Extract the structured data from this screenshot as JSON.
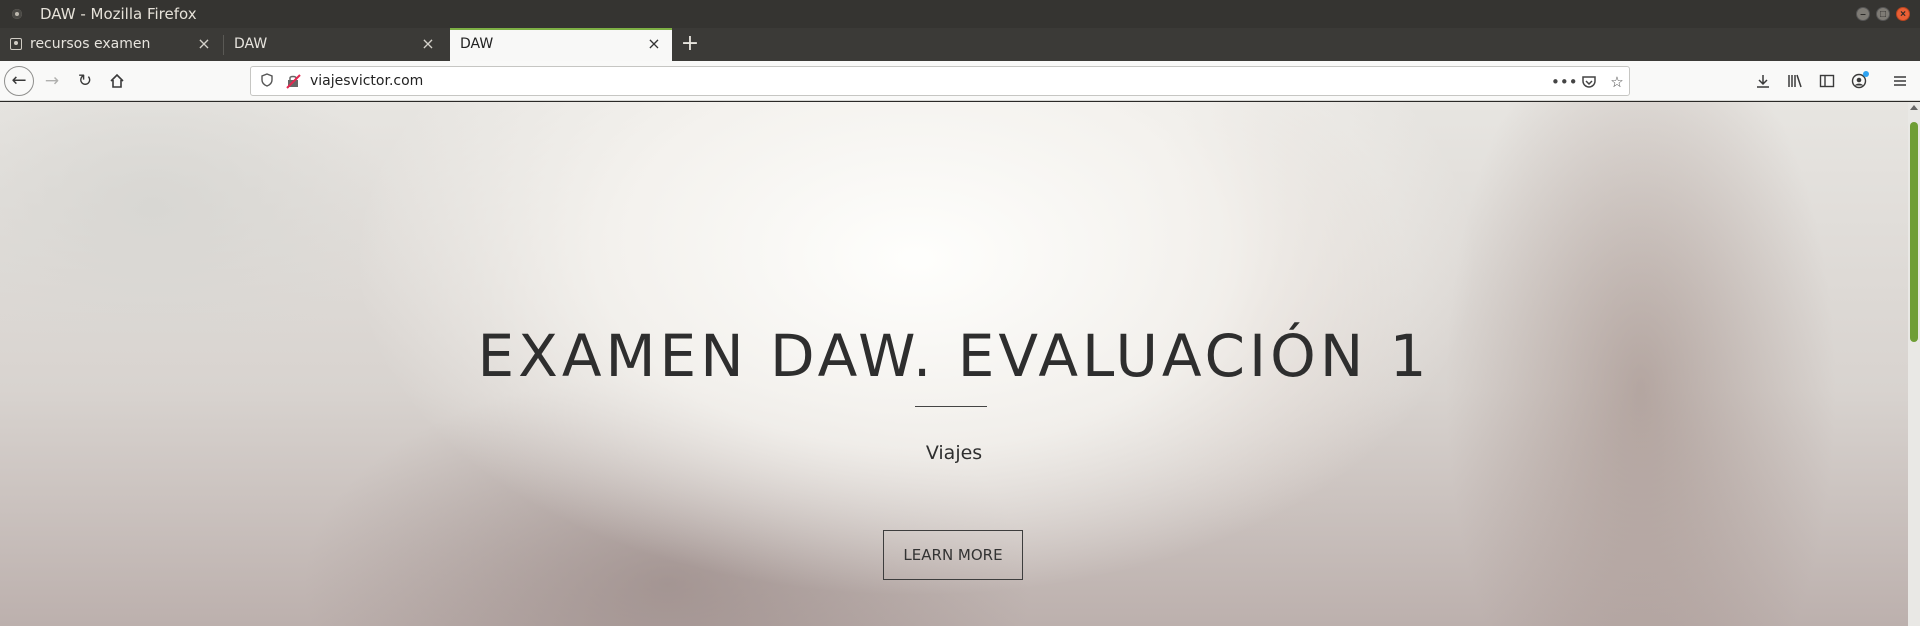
{
  "window": {
    "title": "DAW - Mozilla Firefox"
  },
  "tabs": [
    {
      "label": "recursos examen"
    },
    {
      "label": "DAW"
    },
    {
      "label": "DAW",
      "active": true
    }
  ],
  "nav": {
    "url": "viajesvictor.com"
  },
  "hero": {
    "title": "EXAMEN DAW. EVALUACIÓN 1",
    "subtitle": "Viajes",
    "button_label": "LEARN MORE"
  },
  "icons": {
    "new_tab": "+",
    "close": "×",
    "back": "arrow-left",
    "forward": "arrow-right",
    "reload": "reload",
    "home": "home"
  },
  "colors": {
    "active_tab_accent": "#7eb045",
    "scroll_thumb": "#6f9e36",
    "close_button": "#e95f35"
  }
}
